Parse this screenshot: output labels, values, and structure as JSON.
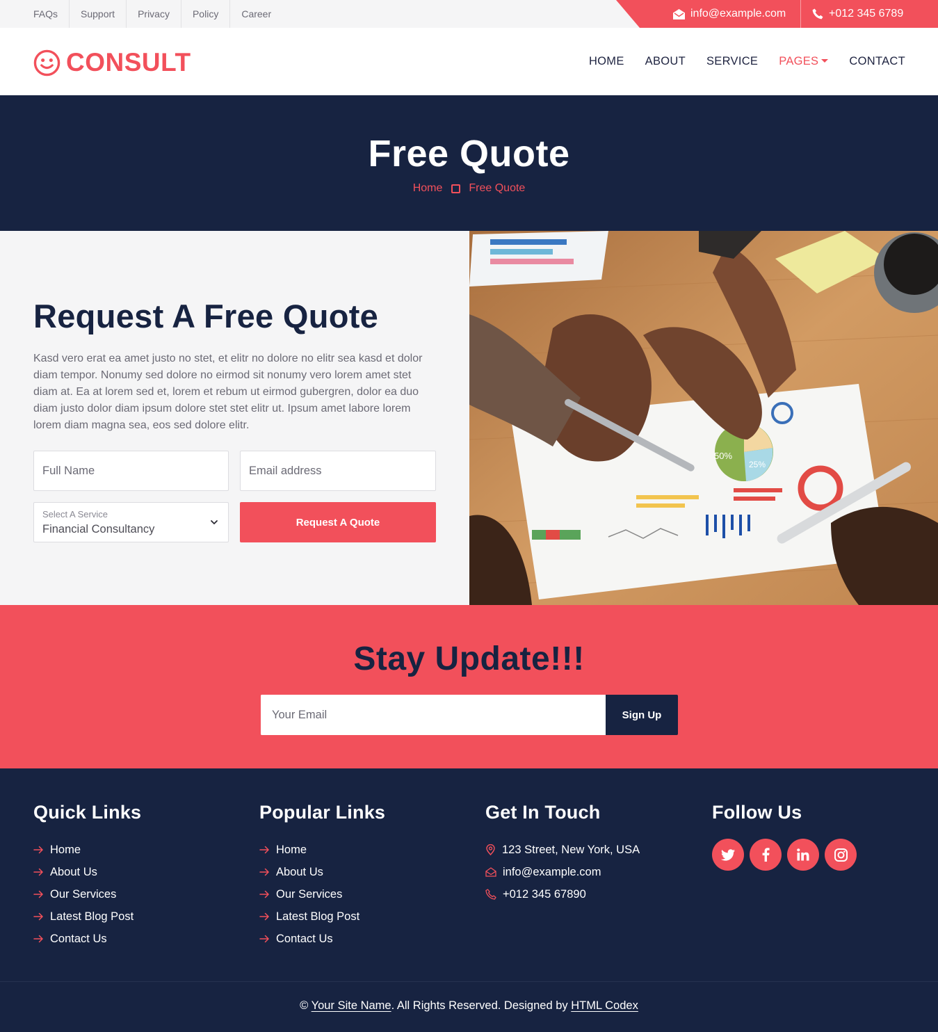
{
  "topbar": {
    "links": [
      "FAQs",
      "Support",
      "Privacy",
      "Policy",
      "Career"
    ],
    "email": "info@example.com",
    "phone": "+012 345 6789"
  },
  "nav": {
    "brand": "CONSULT",
    "items": [
      "HOME",
      "ABOUT",
      "SERVICE",
      "PAGES",
      "CONTACT"
    ],
    "active_item": "PAGES"
  },
  "hero": {
    "title": "Free Quote",
    "breadcrumb": [
      "Home",
      "Free Quote"
    ]
  },
  "quote": {
    "title": "Request A Free Quote",
    "text": "Kasd vero erat ea amet justo no stet, et elitr no dolore no elitr sea kasd et dolor diam tempor. Nonumy sed dolore no eirmod sit nonumy vero lorem amet stet diam at. Ea at lorem sed et, lorem et rebum ut eirmod gubergren, dolor ea duo diam justo dolor diam ipsum dolore stet stet elitr ut. Ipsum amet labore lorem lorem diam magna sea, eos sed dolore elitr.",
    "name_placeholder": "Full Name",
    "email_placeholder": "Email address",
    "select_label": "Select A Service",
    "select_value": "Financial Consultancy",
    "button": "Request A Quote",
    "image_chart_labels": [
      "50%",
      "25%"
    ]
  },
  "newsletter": {
    "title": "Stay Update!!!",
    "placeholder": "Your Email",
    "button": "Sign Up"
  },
  "footer": {
    "quick_links": {
      "title": "Quick Links",
      "items": [
        "Home",
        "About Us",
        "Our Services",
        "Latest Blog Post",
        "Contact Us"
      ]
    },
    "popular_links": {
      "title": "Popular Links",
      "items": [
        "Home",
        "About Us",
        "Our Services",
        "Latest Blog Post",
        "Contact Us"
      ]
    },
    "contact": {
      "title": "Get In Touch",
      "address": "123 Street, New York, USA",
      "email": "info@example.com",
      "phone": "+012 345 67890"
    },
    "follow": {
      "title": "Follow Us",
      "networks": [
        "twitter-icon",
        "facebook-icon",
        "linkedin-icon",
        "instagram-icon"
      ]
    },
    "copyright": {
      "symbol": "©",
      "site": "Your Site Name",
      "rights": ". All Rights Reserved. Designed by",
      "designer": "HTML Codex"
    }
  },
  "colors": {
    "accent": "#f2505b",
    "dark": "#172341",
    "light_bg": "#f5f5f6"
  }
}
